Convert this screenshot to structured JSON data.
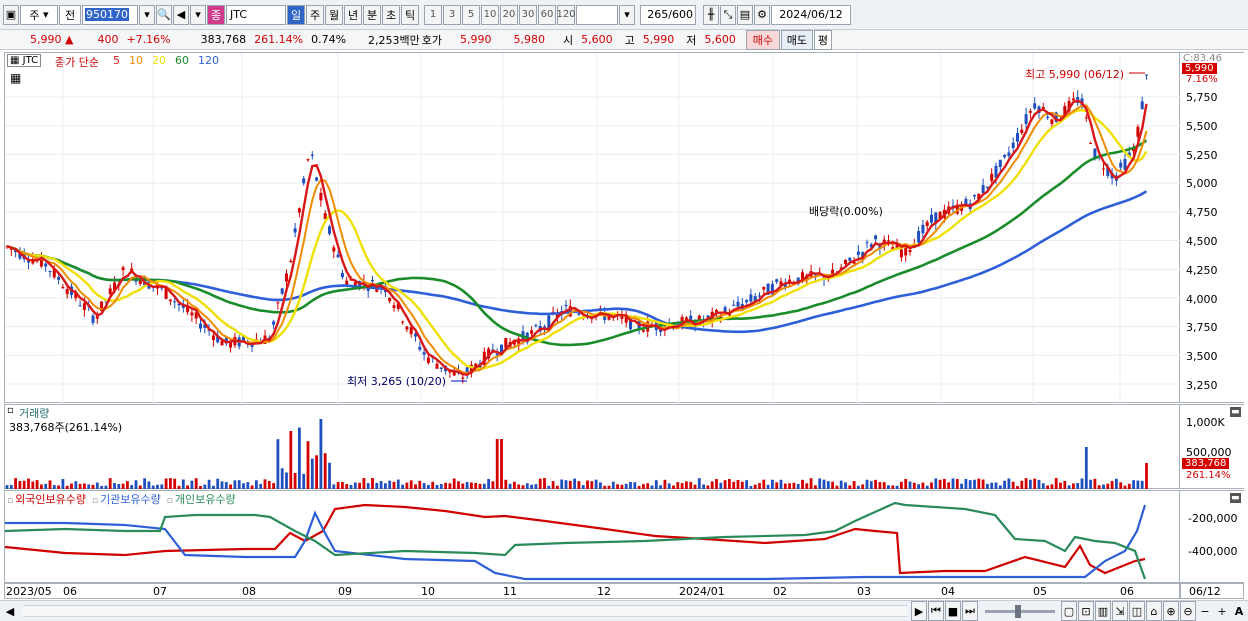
{
  "toolbar": {
    "type_select": "주",
    "prev_label": "전",
    "code": "950170",
    "stock_tag": "종",
    "stock_name": "JTC",
    "periods": [
      "일",
      "주",
      "월",
      "년",
      "분",
      "초",
      "틱"
    ],
    "numbers": [
      "1",
      "3",
      "5",
      "10",
      "20",
      "30",
      "60",
      "120"
    ],
    "count": "265",
    "count_total": "/600",
    "date": "2024/06/12"
  },
  "quote": {
    "price": "5,990 ▲",
    "change": "400",
    "change_pct": "+7.16%",
    "volume": "383,768",
    "volume_pct": "261.14%",
    "turnover": "0.74%",
    "amount": "2,253백만",
    "hoga_label": "호가",
    "ask": "5,990",
    "bid": "5,980",
    "open_label": "시",
    "open": "5,600",
    "high_label": "고",
    "high": "5,990",
    "low_label": "저",
    "low": "5,600",
    "buy": "매수",
    "sell": "매도",
    "avg": "평"
  },
  "price_pane": {
    "tag": "JTC",
    "legend_title": "종가 단순",
    "ma": [
      "5",
      "10",
      "20",
      "60",
      "120"
    ],
    "ma_colors": [
      "#d81818",
      "#f08c00",
      "#f0e000",
      "#1a8c2a",
      "#2f5fd8"
    ],
    "annotation_high": "최고 5,990 (06/12)",
    "annotation_low": "최저 3,265 (10/20)",
    "annotation_div": "배당락(0.00%)",
    "axis_top": "C:83.46",
    "axis_tag_price": "5,990",
    "axis_tag_pct": "7.16%",
    "y_ticks": [
      "5,750",
      "5,500",
      "5,250",
      "5,000",
      "4,750",
      "4,500",
      "4,250",
      "4,000",
      "3,750",
      "3,500",
      "3,250"
    ]
  },
  "volume_pane": {
    "title": "거래량",
    "value": "383,768주(261.14%)",
    "y_ticks": [
      "1,000K",
      "500,000"
    ],
    "axis_tag": "383,768",
    "axis_pct": "261.14%"
  },
  "holdings_pane": {
    "legend": [
      "외국인보유수량",
      "기관보유수량",
      "개인보유수량"
    ],
    "legend_colors": [
      "#d00000",
      "#2f5fd8",
      "#2a8a5a"
    ],
    "y_ticks": [
      "-200,000",
      "-400,000"
    ]
  },
  "x_axis": [
    "2023/05",
    "06",
    "07",
    "08",
    "09",
    "10",
    "11",
    "12",
    "2024/01",
    "02",
    "03",
    "04",
    "05",
    "06"
  ],
  "x_axis_right": "06/12"
}
